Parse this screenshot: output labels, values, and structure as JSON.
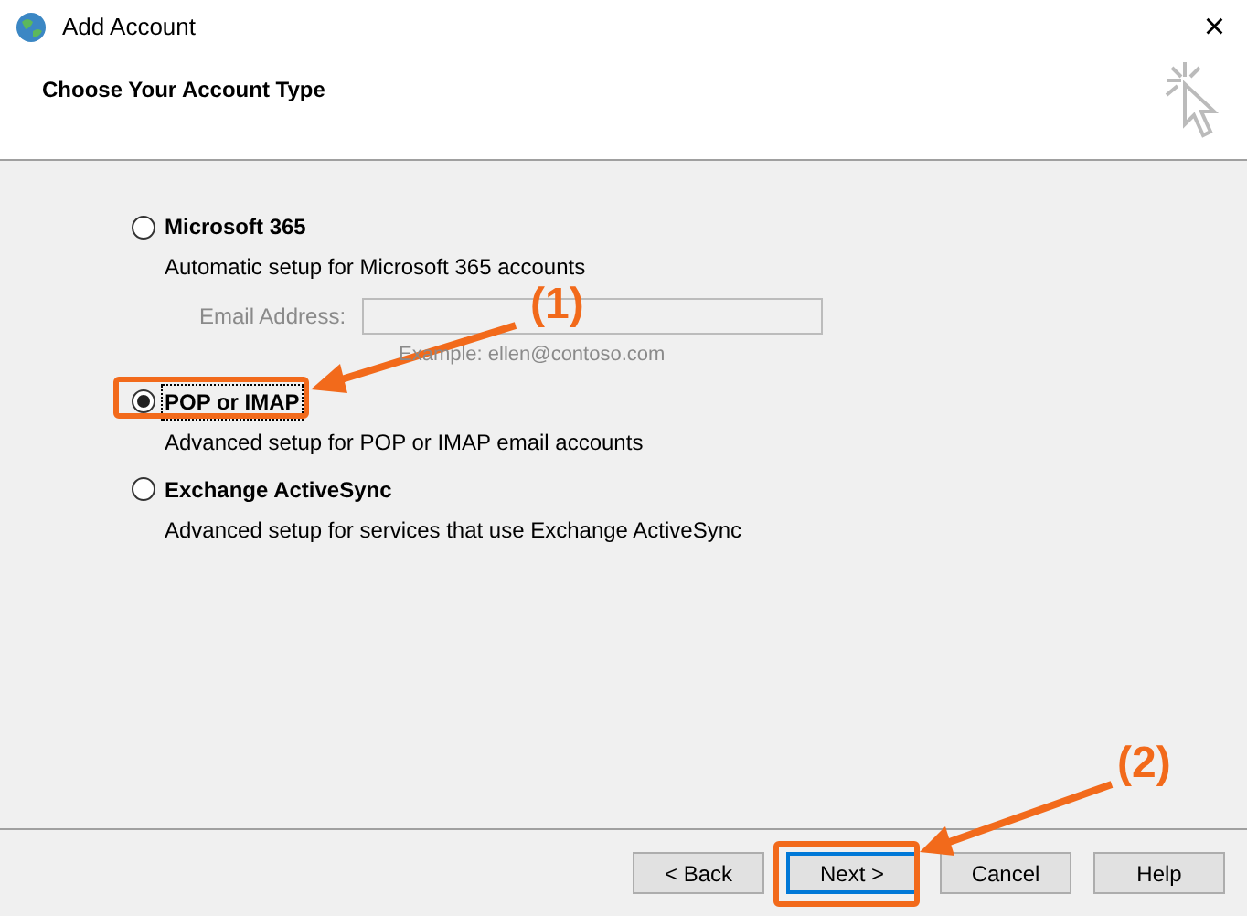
{
  "window": {
    "title": "Add Account",
    "close": "×"
  },
  "header": {
    "title": "Choose Your Account Type"
  },
  "options": [
    {
      "label": "Microsoft 365",
      "description": "Automatic setup for Microsoft 365 accounts",
      "selected": false,
      "email": {
        "label": "Email Address:",
        "disabled": true,
        "hint": "Example: ellen@contoso.com"
      }
    },
    {
      "label": "POP or IMAP",
      "description": "Advanced setup for POP or IMAP email accounts",
      "selected": true
    },
    {
      "label": "Exchange ActiveSync",
      "description": "Advanced setup for services that use Exchange ActiveSync",
      "selected": false
    }
  ],
  "buttons": [
    {
      "label": "< Back",
      "default": false
    },
    {
      "label": "Next >",
      "default": true
    },
    {
      "label": "Cancel",
      "default": false
    },
    {
      "label": "Help",
      "default": false
    }
  ],
  "annotations": [
    {
      "label": "(1)",
      "kind": "option"
    },
    {
      "label": "(2)",
      "kind": "button"
    }
  ]
}
